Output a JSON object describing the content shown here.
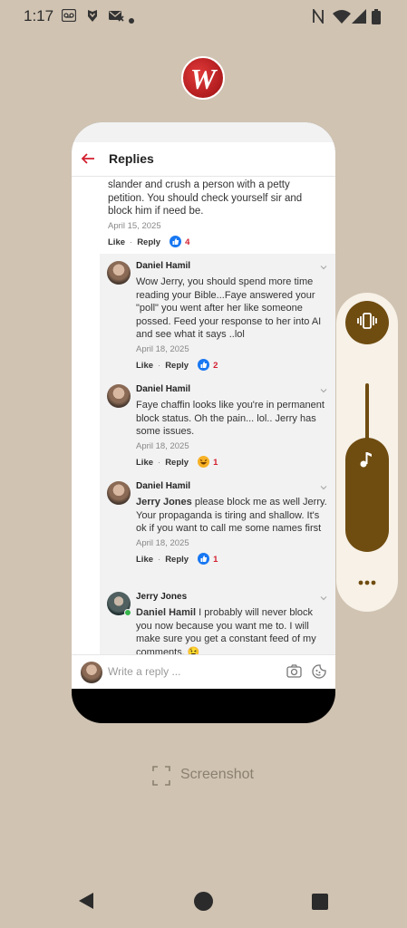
{
  "status_bar": {
    "time": "1:17",
    "icons": [
      "voicemail-icon",
      "shield-icon",
      "missed-call-icon",
      "dot-icon",
      "nfc-icon",
      "wifi-icon",
      "signal-icon",
      "battery-icon"
    ]
  },
  "app": {
    "icon_name": "app-logo-icon"
  },
  "header": {
    "title": "Replies"
  },
  "top_comment": {
    "text": "slander and crush a person with a petty  petition. You should check yourself sir and block him if need be.",
    "date": "April 15, 2025",
    "like": "Like",
    "reply": "Reply",
    "reaction_count": "4"
  },
  "replies": [
    {
      "name": "Daniel Hamil",
      "text": "Wow Jerry, you should spend more time reading your Bible...Faye answered your \"poll\" you went after her like someone possed. Feed your response to her into AI and see what it says ..lol",
      "date": "April 18, 2025",
      "like": "Like",
      "reply": "Reply",
      "reaction_count": "2"
    },
    {
      "name": "Daniel Hamil",
      "text": "Faye chaffin looks like you're in permanent block status. Oh the pain... lol.. Jerry has some issues.",
      "date": "April 18, 2025",
      "like": "Like",
      "reply": "Reply",
      "reaction_count": "1"
    },
    {
      "name": "Daniel Hamil",
      "mention": "Jerry Jones",
      "text": " please block me as well Jerry. Your propaganda is tiring and shallow. It's ok if you want to call me some names first",
      "date": "April 18, 2025",
      "like": "Like",
      "reply": "Reply",
      "reaction_count": "1"
    },
    {
      "name": "Jerry Jones",
      "mention": "Daniel Hamil",
      "text": " I probably will never block you now because you want me to.  I will make sure you get a constant feed of my comments. 😉"
    }
  ],
  "composer": {
    "placeholder": "Write a reply ..."
  },
  "screenshot_label": "Screenshot",
  "colors": {
    "accent": "#d31f2f",
    "volume": "#6f4c10",
    "like_blue": "#1877f2"
  }
}
